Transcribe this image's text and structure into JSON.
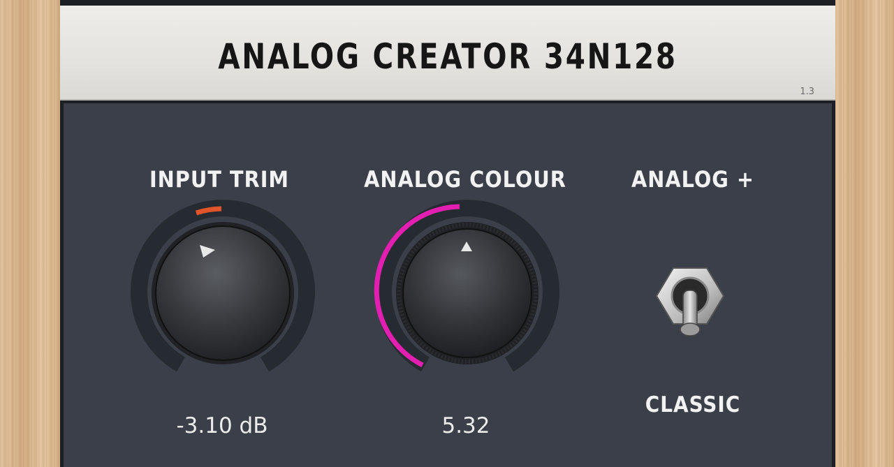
{
  "plugin": {
    "title": "ANALOG CREATOR 34N128",
    "version": "1.3"
  },
  "controls": {
    "input_trim": {
      "label": "INPUT TRIM",
      "value_text": "-3.10 dB",
      "accent": "#e2552b"
    },
    "analog_colour": {
      "label": "ANALOG COLOUR",
      "value_text": "5.32",
      "accent": "#e21fb0"
    },
    "analog_plus": {
      "label": "ANALOG +",
      "state_text": "CLASSIC"
    }
  },
  "colors": {
    "panel": "#3a3f49",
    "header": "#e4e3df",
    "ring": "#262a31"
  }
}
